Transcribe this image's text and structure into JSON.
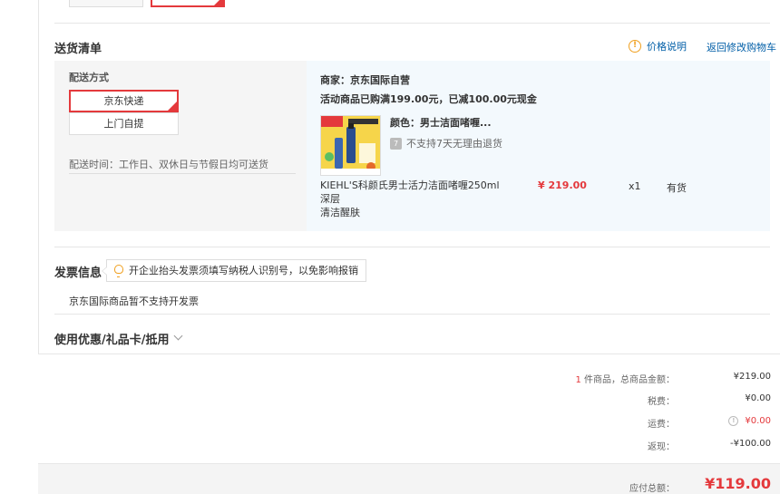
{
  "delivery": {
    "title": "送货清单",
    "price_info_link": "价格说明",
    "back_to_cart_link": "返回修改购物车",
    "shipping": {
      "label": "配送方式",
      "options": [
        "京东快递",
        "上门自提"
      ],
      "selected": "京东快递",
      "time_text": "配送时间：工作日、双休日与节假日均可送货"
    },
    "order": {
      "merchant": "商家：京东国际自营",
      "promo": "活动商品已购满199.00元，已减100.00元现金",
      "product": {
        "color": "颜色：男士洁面啫喱...",
        "no_return": "不支持7天无理由退货",
        "name_line1": "KIEHL'S科颜氏男士活力洁面啫喱250ml 深层",
        "name_line2": "清洁醒肤",
        "price": "¥ 219.00",
        "quantity": "x1",
        "stock": "有货"
      }
    }
  },
  "invoice": {
    "title": "发票信息",
    "tip": "开企业抬头发票须填写纳税人识别号，以免影响报销",
    "note": "京东国际商品暂不支持开发票"
  },
  "coupon": {
    "title": "使用优惠/礼品卡/抵用"
  },
  "summary": {
    "item_count": "1",
    "item_count_suffix": " 件商品，总商品金额：",
    "goods_total": "¥219.00",
    "tax_label": "税费：",
    "tax_value": "¥0.00",
    "shipping_label": "运费：",
    "shipping_value": "¥0.00",
    "cashback_label": "返现：",
    "cashback_value": "-¥100.00",
    "payable_label": "应付总额：",
    "payable_value": "¥119.00"
  },
  "colors": {
    "accent_red": "#e4393c",
    "link_blue": "#005ea7",
    "panel_bg": "#f3f9fd"
  }
}
